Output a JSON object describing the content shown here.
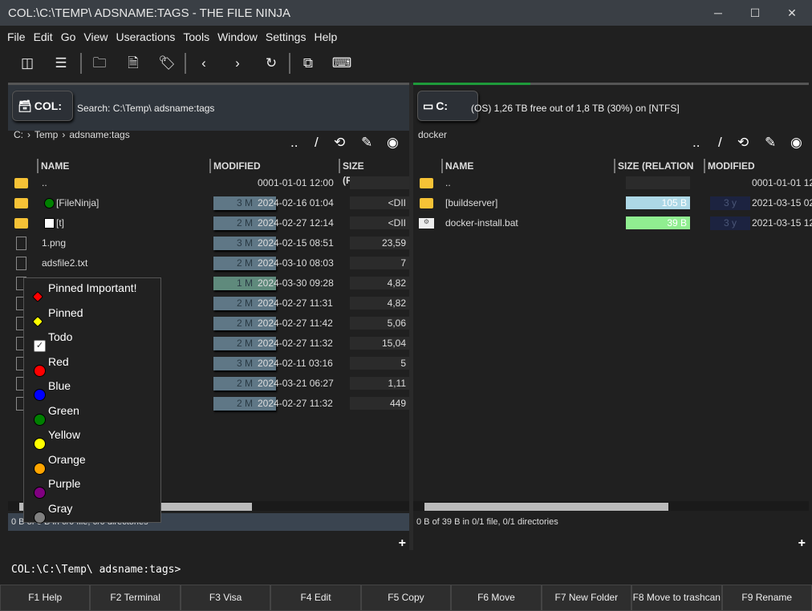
{
  "window": {
    "title": "COL:\\C:\\TEMP\\  ADSNAME:TAGS -  THE FILE NINJA",
    "minimize": "─",
    "maximize": "☐",
    "close": "✕"
  },
  "menu": [
    "File",
    "Edit",
    "Go",
    "View",
    "Useractions",
    "Tools",
    "Window",
    "Settings",
    "Help"
  ],
  "toolbar": [
    {
      "icon": "sidebar-icon",
      "glyph": "◫"
    },
    {
      "icon": "list-icon",
      "glyph": "☰"
    },
    {
      "icon": "new-folder-icon",
      "glyph": "🗀"
    },
    {
      "icon": "new-file-icon",
      "glyph": "🗎"
    },
    {
      "icon": "tag-icon",
      "glyph": "🏷"
    },
    {
      "icon": "back-icon",
      "glyph": "‹"
    },
    {
      "icon": "forward-icon",
      "glyph": "›"
    },
    {
      "icon": "refresh-icon",
      "glyph": "↻"
    },
    {
      "icon": "copy-window-icon",
      "glyph": "⧉"
    },
    {
      "icon": "terminal-icon",
      "glyph": "⌨"
    }
  ],
  "left": {
    "drive": "COL:",
    "info": "Search: C:\\Temp\\  adsname:tags",
    "breadcrumb": [
      "C:",
      "Temp",
      "adsname:tags"
    ],
    "icons": {
      "up": "..",
      "root": "/",
      "history": "⟲",
      "pin": "✎",
      "eye": "◉"
    },
    "columns": [
      "NAME",
      "MODIFIED",
      "SIZE (RELATION"
    ],
    "rows": [
      {
        "type": "folder",
        "name": "..",
        "age": "",
        "modified": "0001-01-01 12:00",
        "size": ""
      },
      {
        "type": "folder",
        "tag": "#008000",
        "name": "[FileNinja]",
        "age": "3 M",
        "modified": "2024-02-16 01:04",
        "size": "<DII"
      },
      {
        "type": "folder",
        "tag": "#ffffff",
        "name": "[t]",
        "age": "2 M",
        "modified": "2024-02-27 12:14",
        "size": "<DII"
      },
      {
        "type": "file",
        "name": "1.png",
        "age": "3 M",
        "modified": "2024-02-15 08:51",
        "size": "23,59"
      },
      {
        "type": "file",
        "name": "adsfile2.txt",
        "age": "2 M",
        "modified": "2024-03-10 08:03",
        "size": "7"
      },
      {
        "type": "file",
        "name": "",
        "age": "1 M",
        "modified": "2024-03-30 09:28",
        "size": "4,82"
      },
      {
        "type": "file",
        "name": "",
        "age": "2 M",
        "modified": "2024-02-27 11:31",
        "size": "4,82"
      },
      {
        "type": "file",
        "name": "",
        "age": "2 M",
        "modified": "2024-02-27 11:42",
        "size": "5,06"
      },
      {
        "type": "file",
        "name": "",
        "age": "2 M",
        "modified": "2024-02-27 11:32",
        "size": "15,04"
      },
      {
        "type": "file",
        "name": "",
        "age": "3 M",
        "modified": "2024-02-11 03:16",
        "size": "5"
      },
      {
        "type": "file",
        "name": "",
        "age": "2 M",
        "modified": "2024-03-21 06:27",
        "size": "1,11"
      },
      {
        "type": "file",
        "name": "",
        "age": "2 M",
        "modified": "2024-02-27 11:32",
        "size": "449"
      }
    ],
    "status": "0 B of 0 B in 0/0 file, 0/0 directories",
    "add": "+"
  },
  "right": {
    "drive": "C:",
    "info": "(OS) 1,26 TB free out of 1,8 TB (30%) on  [NTFS]",
    "breadcrumb": "docker",
    "icons": {
      "up": "..",
      "root": "/",
      "history": "⟲",
      "pin": "✎",
      "eye": "◉"
    },
    "columns": [
      "NAME",
      "SIZE (RELATION",
      "MODIFIED"
    ],
    "rows": [
      {
        "type": "folder",
        "name": "..",
        "size": "",
        "bar": "",
        "age": "",
        "modified": "0001-01-01 12:00"
      },
      {
        "type": "folder",
        "name": "[buildserver]",
        "size": "105 B",
        "bar": "#add8e6",
        "age": "3 y",
        "modified": "2021-03-15 02"
      },
      {
        "type": "bat",
        "name": "docker-install.bat",
        "size": "39 B",
        "bar": "#90ee90",
        "age": "3 y",
        "modified": "2021-03-15 12"
      }
    ],
    "status": "0 B of 39 B in 0/1 file, 0/1 directories",
    "add": "+"
  },
  "tag_menu": [
    {
      "label": "Pinned Important!",
      "icon": "pin-red-icon",
      "color": "#ff0000"
    },
    {
      "label": "Pinned",
      "icon": "pin-yellow-icon",
      "color": "#ffff00"
    },
    {
      "label": "Todo",
      "icon": "checkbox-icon",
      "color": "#ffffff"
    },
    {
      "label": "Red",
      "icon": "circle-icon",
      "color": "#ff0000"
    },
    {
      "label": "Blue",
      "icon": "circle-icon",
      "color": "#0000ff"
    },
    {
      "label": "Green",
      "icon": "circle-icon",
      "color": "#008000"
    },
    {
      "label": "Yellow",
      "icon": "circle-icon",
      "color": "#ffff00"
    },
    {
      "label": "Orange",
      "icon": "circle-icon",
      "color": "#ffa500"
    },
    {
      "label": "Purple",
      "icon": "circle-icon",
      "color": "#800080"
    },
    {
      "label": "Gray",
      "icon": "circle-icon",
      "color": "#808080"
    }
  ],
  "command_line": "COL:\\C:\\Temp\\  adsname:tags>",
  "fkeys": [
    "F1 Help",
    "F2 Terminal",
    "F3 Visa",
    "F4 Edit",
    "F5 Copy",
    "F6 Move",
    "F7 New Folder",
    "F8 Move to trashcan",
    "F9 Rename"
  ]
}
